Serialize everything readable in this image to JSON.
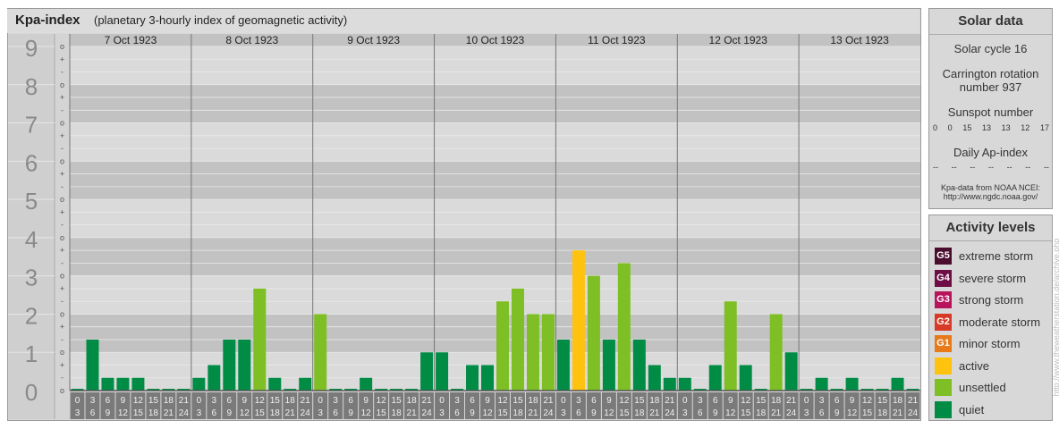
{
  "header": {
    "title": "Kpa-index",
    "subtitle": "(planetary 3-hourly index of geomagnetic activity)"
  },
  "chart_data": {
    "type": "bar",
    "y_levels": [
      "0",
      "1",
      "2",
      "3",
      "4",
      "5",
      "6",
      "7",
      "8",
      "9"
    ],
    "y_sublabels": [
      "o",
      "-",
      "+",
      "o",
      "-",
      "+",
      "o",
      "-",
      "+",
      "o",
      "-",
      "+",
      "o",
      "-",
      "+",
      "o",
      "-",
      "+",
      "o",
      "-",
      "+",
      "o",
      "-",
      "+",
      "o",
      "-",
      "+",
      "o"
    ],
    "ylim": [
      0,
      9
    ],
    "days": [
      "7 Oct 1923",
      "8 Oct 1923",
      "9 Oct 1923",
      "10 Oct 1923",
      "11 Oct 1923",
      "12 Oct 1923",
      "13 Oct 1923"
    ],
    "interval_labels": [
      [
        "0",
        "3"
      ],
      [
        "3",
        "6"
      ],
      [
        "6",
        "9"
      ],
      [
        "9",
        "12"
      ],
      [
        "12",
        "15"
      ],
      [
        "15",
        "18"
      ],
      [
        "18",
        "21"
      ],
      [
        "21",
        "24"
      ]
    ],
    "values": [
      [
        0.0,
        1.333,
        0.333,
        0.333,
        0.333,
        0.0,
        0.0,
        0.0
      ],
      [
        0.333,
        0.667,
        1.333,
        1.333,
        2.667,
        0.333,
        0.0,
        0.333
      ],
      [
        2.0,
        0.0,
        0.0,
        0.333,
        0.0,
        0.0,
        0.0,
        1.0
      ],
      [
        1.0,
        0.0,
        0.667,
        0.667,
        2.333,
        2.667,
        2.0,
        2.0
      ],
      [
        1.333,
        3.667,
        3.0,
        1.333,
        3.333,
        1.333,
        0.667,
        0.333
      ],
      [
        0.333,
        0.0,
        0.667,
        2.333,
        0.667,
        0.0,
        2.0,
        1.0
      ],
      [
        0.0,
        0.333,
        0.0,
        0.333,
        0.0,
        0.0,
        0.333,
        0.0
      ]
    ],
    "colors": {
      "quiet": "#008c45",
      "unsettled": "#7dbf25",
      "active": "#ffc20e",
      "band_dark": "#c2c2c2",
      "band_light": "#dadada",
      "grid_line": "#ebebeb",
      "left_axis_bg": "#cfcfcf",
      "y_label": "#8a8a8a",
      "interval_box": "#7a7a7a"
    },
    "grid": true,
    "legend_position": "right"
  },
  "solar": {
    "heading": "Solar data",
    "cycle": "Solar cycle 16",
    "carrington_line1": "Carrington rotation",
    "carrington_line2": "number 937",
    "sunspot_label": "Sunspot number",
    "sunspot_values": [
      "0",
      "0",
      "15",
      "13",
      "13",
      "12",
      "17"
    ],
    "ap_label": "Daily Ap-index",
    "ap_values": [
      "--",
      "--",
      "--",
      "--",
      "--",
      "--",
      "--"
    ],
    "source_line1": "Kpa-data from NOAA NCEI:",
    "source_line2": "http://www.ngdc.noaa.gov/"
  },
  "activity": {
    "heading": "Activity levels",
    "levels": [
      {
        "badge": "G5",
        "label": "extreme storm",
        "color": "#4a0d2e"
      },
      {
        "badge": "G4",
        "label": "severe storm",
        "color": "#6d0f45"
      },
      {
        "badge": "G3",
        "label": "strong storm",
        "color": "#b8145c"
      },
      {
        "badge": "G2",
        "label": "moderate storm",
        "color": "#d73a26"
      },
      {
        "badge": "G1",
        "label": "minor storm",
        "color": "#e87a1a"
      },
      {
        "badge": "",
        "label": "active",
        "color": "#ffc20e"
      },
      {
        "badge": "",
        "label": "unsettled",
        "color": "#7dbf25"
      },
      {
        "badge": "",
        "label": "quiet",
        "color": "#008c45"
      }
    ]
  },
  "watermark": "http://www.theweatherstation.de/archive.php"
}
